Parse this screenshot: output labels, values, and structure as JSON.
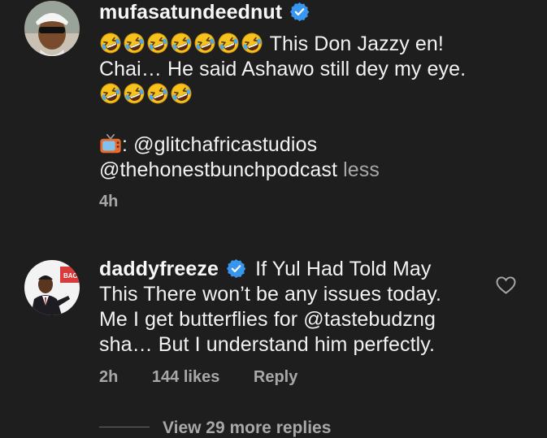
{
  "comments": [
    {
      "username": "mufasatundeednut",
      "verified": true,
      "laugh_emoji_count_line1": 7,
      "text_line1": " This Don Jazzy en!",
      "text_line2": "Chai… He said Ashawo still dey my eye.",
      "laugh_emoji_count_line3": 4,
      "tv_emoji": "television-icon",
      "mention_line1": ": @glitchafricastudios",
      "mention_line2": "@thehonestbunchpodcast",
      "less_label": " less",
      "time": "4h"
    },
    {
      "username": "daddyfreeze",
      "verified": true,
      "text_line1": " If Yul Had Told May",
      "text_line2": "This There won’t be any issues today.",
      "text_line3": "Me I get butterflies for @tastebudzng",
      "text_line4": "sha… But I understand him perfectly.",
      "time": "2h",
      "likes": "144 likes",
      "reply_label": "Reply"
    }
  ],
  "view_replies": "View 29 more replies",
  "colors": {
    "background": "#1e1e1e",
    "text": "#f2f2f2",
    "muted": "#a8a8a8",
    "verified": "#3797f0"
  }
}
